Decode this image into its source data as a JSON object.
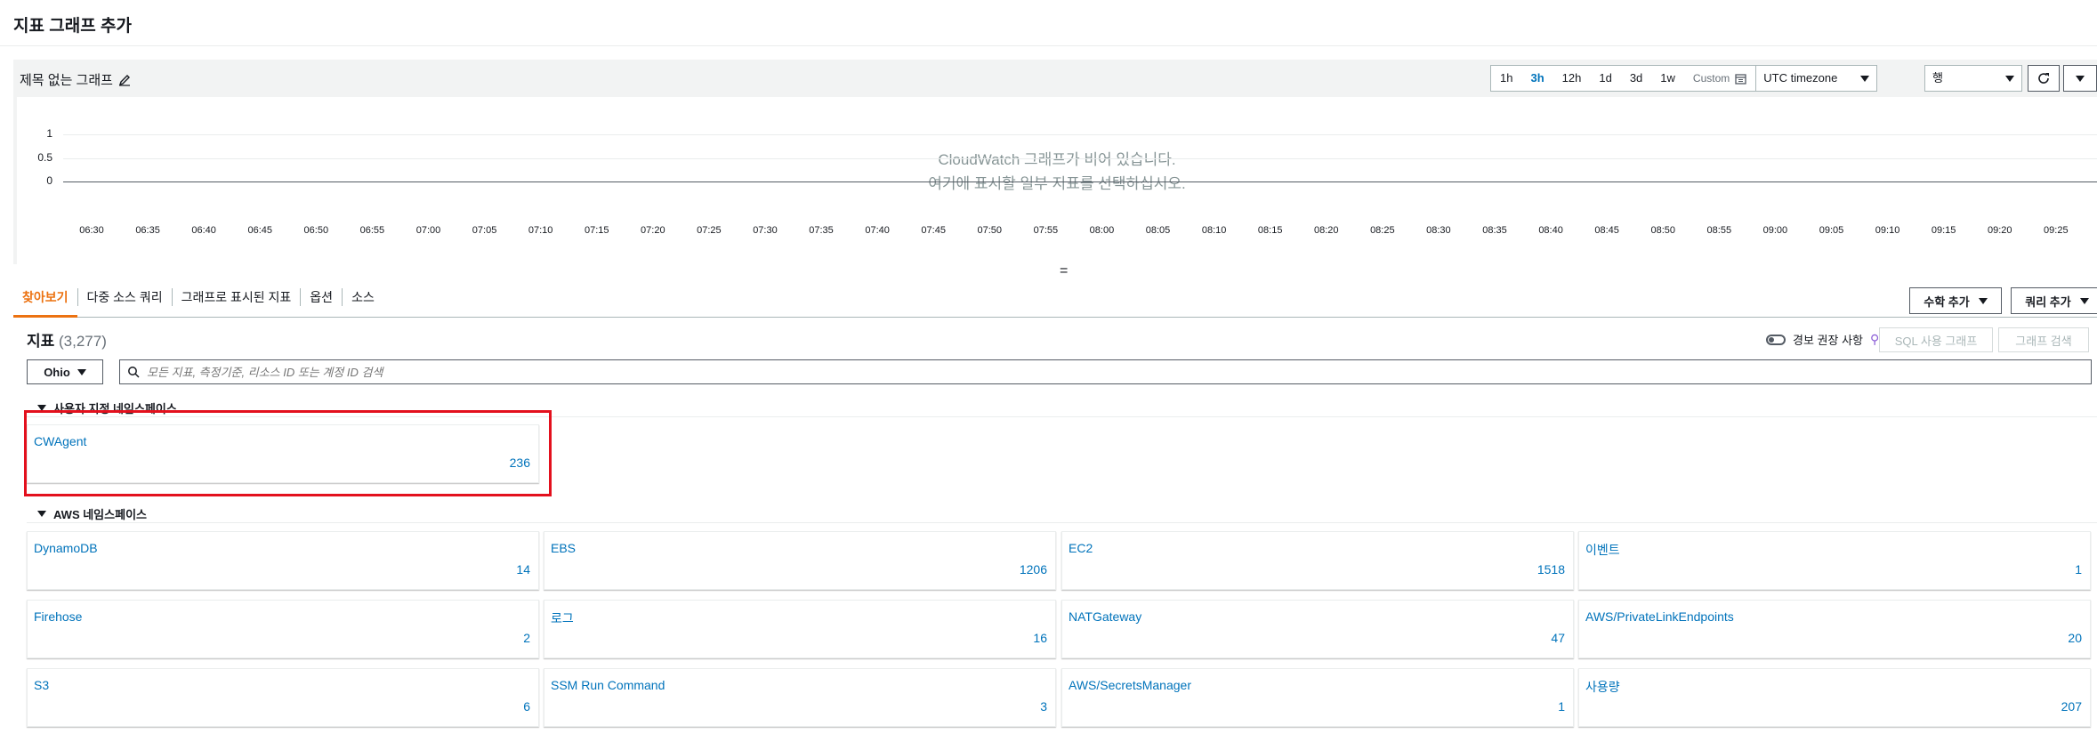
{
  "page": {
    "title": "지표 그래프 추가"
  },
  "graph": {
    "name": "제목 없는 그래프",
    "time_ranges": [
      "1h",
      "3h",
      "12h",
      "1d",
      "3d",
      "1w"
    ],
    "active_range": "3h",
    "custom_label": "Custom",
    "timezone": "UTC timezone",
    "graph_type": "행",
    "empty_line1": "CloudWatch 그래프가 비어 있습니다.",
    "empty_line2": "여기에 표시할 일부 지표를 선택하십시오.",
    "y_ticks": [
      "1",
      "0.5",
      "0"
    ],
    "x_ticks": [
      "06:30",
      "06:35",
      "06:40",
      "06:45",
      "06:50",
      "06:55",
      "07:00",
      "07:05",
      "07:10",
      "07:15",
      "07:20",
      "07:25",
      "07:30",
      "07:35",
      "07:40",
      "07:45",
      "07:50",
      "07:55",
      "08:00",
      "08:05",
      "08:10",
      "08:15",
      "08:20",
      "08:25",
      "08:30",
      "08:35",
      "08:40",
      "08:45",
      "08:50",
      "08:55",
      "09:00",
      "09:05",
      "09:10",
      "09:15",
      "09:20",
      "09:25"
    ]
  },
  "drag_handle": "=",
  "tabs": [
    {
      "label": "찾아보기",
      "active": true
    },
    {
      "label": "다중 소스 쿼리",
      "active": false
    },
    {
      "label": "그래프로 표시된 지표",
      "active": false
    },
    {
      "label": "옵션",
      "active": false
    },
    {
      "label": "소스",
      "active": false
    }
  ],
  "actions": {
    "math": "수학 추가",
    "query": "쿼리 추가"
  },
  "metrics": {
    "title": "지표",
    "count": "(3,277)",
    "alarm_label": "경보 권장 사항",
    "sql_button": "SQL 사용 그래프",
    "graph_search_button": "그래프 검색",
    "region": "Ohio",
    "search_placeholder": "모든 지표, 측정기준, 리소스 ID 또는 계정 ID 검색"
  },
  "custom_namespaces": {
    "header": "사용자 지정 네임스페이스",
    "items": [
      {
        "name": "CWAgent",
        "count": "236"
      }
    ]
  },
  "aws_namespaces": {
    "header": "AWS 네임스페이스",
    "items": [
      {
        "name": "DynamoDB",
        "count": "14"
      },
      {
        "name": "EBS",
        "count": "1206"
      },
      {
        "name": "EC2",
        "count": "1518"
      },
      {
        "name": "이벤트",
        "count": "1"
      },
      {
        "name": "Firehose",
        "count": "2"
      },
      {
        "name": "로그",
        "count": "16"
      },
      {
        "name": "NATGateway",
        "count": "47"
      },
      {
        "name": "AWS/PrivateLinkEndpoints",
        "count": "20"
      },
      {
        "name": "S3",
        "count": "6"
      },
      {
        "name": "SSM Run Command",
        "count": "3"
      },
      {
        "name": "AWS/SecretsManager",
        "count": "1"
      },
      {
        "name": "사용량",
        "count": "207"
      }
    ]
  },
  "colors": {
    "link": "#0073bb",
    "active_tab": "#ec7211",
    "highlight": "#e3101d"
  }
}
